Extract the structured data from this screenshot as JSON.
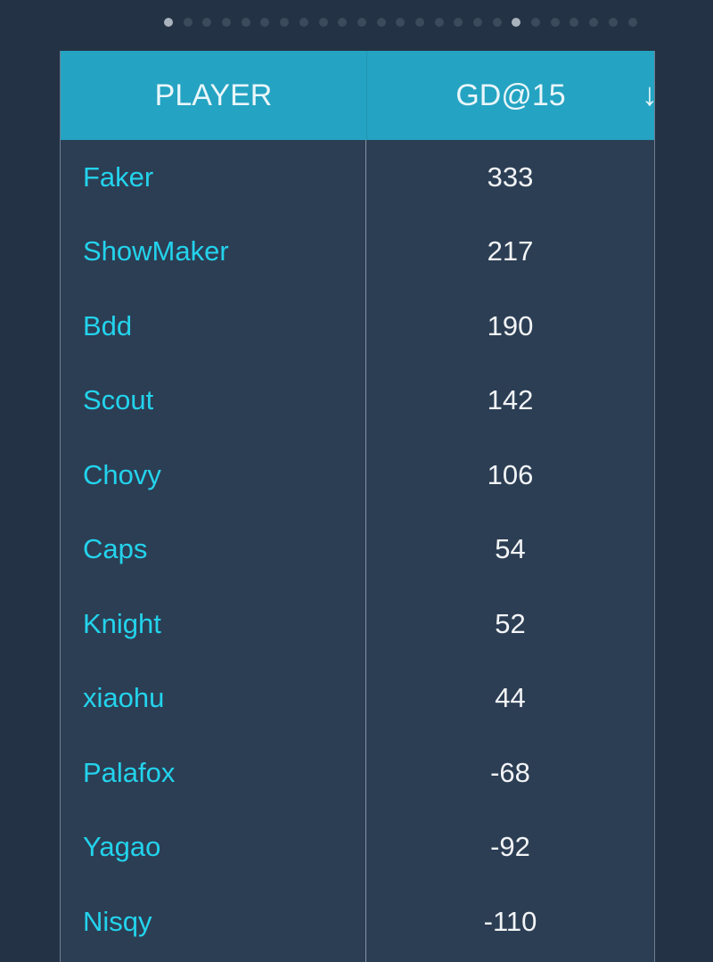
{
  "pager": {
    "count": 25,
    "active": [
      0,
      18
    ]
  },
  "table": {
    "headers": {
      "player": "PLAYER",
      "stat": "GD@15",
      "sort_icon": "arrow-down-icon",
      "sort_glyph": "↓"
    },
    "rows": [
      {
        "player": "Faker",
        "value": "333"
      },
      {
        "player": "ShowMaker",
        "value": "217"
      },
      {
        "player": "Bdd",
        "value": "190"
      },
      {
        "player": "Scout",
        "value": "142"
      },
      {
        "player": "Chovy",
        "value": "106"
      },
      {
        "player": "Caps",
        "value": "54"
      },
      {
        "player": "Knight",
        "value": "52"
      },
      {
        "player": "xiaohu",
        "value": "44"
      },
      {
        "player": "Palafox",
        "value": "-68"
      },
      {
        "player": "Yagao",
        "value": "-92"
      },
      {
        "player": "Nisqy",
        "value": "-110"
      }
    ]
  },
  "colors": {
    "header": "#24a3c2",
    "player_name": "#23d3ec",
    "background": "#233244",
    "table_body": "#2c3e54"
  }
}
